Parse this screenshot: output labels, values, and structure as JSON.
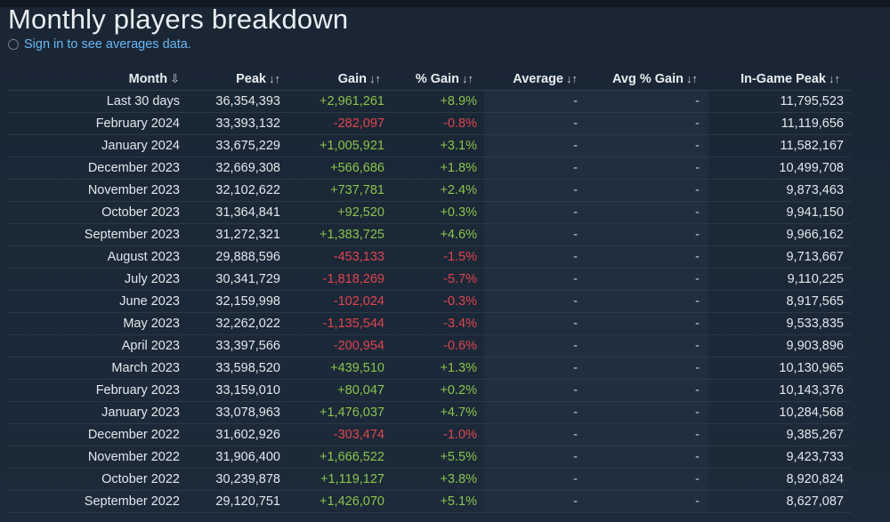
{
  "page": {
    "title": "Monthly players breakdown",
    "signin_text": "Sign in to see averages data."
  },
  "table": {
    "headers": {
      "month": "Month",
      "peak": "Peak",
      "gain": "Gain",
      "gain_pct": "% Gain",
      "average": "Average",
      "avg_gain_pct": "Avg % Gain",
      "ingame_peak": "In-Game Peak"
    },
    "sort_icons": {
      "month": "⇩",
      "other": "↓↑"
    },
    "rows": [
      {
        "month": "Last 30 days",
        "peak": "36,354,393",
        "gain": "+2,961,261",
        "gain_pct": "+8.9%",
        "average": "-",
        "avg_gain_pct": "-",
        "ingame_peak": "11,795,523",
        "trend": "pos"
      },
      {
        "month": "February 2024",
        "peak": "33,393,132",
        "gain": "-282,097",
        "gain_pct": "-0.8%",
        "average": "-",
        "avg_gain_pct": "-",
        "ingame_peak": "11,119,656",
        "trend": "neg"
      },
      {
        "month": "January 2024",
        "peak": "33,675,229",
        "gain": "+1,005,921",
        "gain_pct": "+3.1%",
        "average": "-",
        "avg_gain_pct": "-",
        "ingame_peak": "11,582,167",
        "trend": "pos"
      },
      {
        "month": "December 2023",
        "peak": "32,669,308",
        "gain": "+566,686",
        "gain_pct": "+1.8%",
        "average": "-",
        "avg_gain_pct": "-",
        "ingame_peak": "10,499,708",
        "trend": "pos"
      },
      {
        "month": "November 2023",
        "peak": "32,102,622",
        "gain": "+737,781",
        "gain_pct": "+2.4%",
        "average": "-",
        "avg_gain_pct": "-",
        "ingame_peak": "9,873,463",
        "trend": "pos"
      },
      {
        "month": "October 2023",
        "peak": "31,364,841",
        "gain": "+92,520",
        "gain_pct": "+0.3%",
        "average": "-",
        "avg_gain_pct": "-",
        "ingame_peak": "9,941,150",
        "trend": "pos"
      },
      {
        "month": "September 2023",
        "peak": "31,272,321",
        "gain": "+1,383,725",
        "gain_pct": "+4.6%",
        "average": "-",
        "avg_gain_pct": "-",
        "ingame_peak": "9,966,162",
        "trend": "pos"
      },
      {
        "month": "August 2023",
        "peak": "29,888,596",
        "gain": "-453,133",
        "gain_pct": "-1.5%",
        "average": "-",
        "avg_gain_pct": "-",
        "ingame_peak": "9,713,667",
        "trend": "neg"
      },
      {
        "month": "July 2023",
        "peak": "30,341,729",
        "gain": "-1,818,269",
        "gain_pct": "-5.7%",
        "average": "-",
        "avg_gain_pct": "-",
        "ingame_peak": "9,110,225",
        "trend": "neg"
      },
      {
        "month": "June 2023",
        "peak": "32,159,998",
        "gain": "-102,024",
        "gain_pct": "-0.3%",
        "average": "-",
        "avg_gain_pct": "-",
        "ingame_peak": "8,917,565",
        "trend": "neg"
      },
      {
        "month": "May 2023",
        "peak": "32,262,022",
        "gain": "-1,135,544",
        "gain_pct": "-3.4%",
        "average": "-",
        "avg_gain_pct": "-",
        "ingame_peak": "9,533,835",
        "trend": "neg"
      },
      {
        "month": "April 2023",
        "peak": "33,397,566",
        "gain": "-200,954",
        "gain_pct": "-0.6%",
        "average": "-",
        "avg_gain_pct": "-",
        "ingame_peak": "9,903,896",
        "trend": "neg"
      },
      {
        "month": "March 2023",
        "peak": "33,598,520",
        "gain": "+439,510",
        "gain_pct": "+1.3%",
        "average": "-",
        "avg_gain_pct": "-",
        "ingame_peak": "10,130,965",
        "trend": "pos"
      },
      {
        "month": "February 2023",
        "peak": "33,159,010",
        "gain": "+80,047",
        "gain_pct": "+0.2%",
        "average": "-",
        "avg_gain_pct": "-",
        "ingame_peak": "10,143,376",
        "trend": "pos"
      },
      {
        "month": "January 2023",
        "peak": "33,078,963",
        "gain": "+1,476,037",
        "gain_pct": "+4.7%",
        "average": "-",
        "avg_gain_pct": "-",
        "ingame_peak": "10,284,568",
        "trend": "pos"
      },
      {
        "month": "December 2022",
        "peak": "31,602,926",
        "gain": "-303,474",
        "gain_pct": "-1.0%",
        "average": "-",
        "avg_gain_pct": "-",
        "ingame_peak": "9,385,267",
        "trend": "neg"
      },
      {
        "month": "November 2022",
        "peak": "31,906,400",
        "gain": "+1,666,522",
        "gain_pct": "+5.5%",
        "average": "-",
        "avg_gain_pct": "-",
        "ingame_peak": "9,423,733",
        "trend": "pos"
      },
      {
        "month": "October 2022",
        "peak": "30,239,878",
        "gain": "+1,119,127",
        "gain_pct": "+3.8%",
        "average": "-",
        "avg_gain_pct": "-",
        "ingame_peak": "8,920,824",
        "trend": "pos"
      },
      {
        "month": "September 2022",
        "peak": "29,120,751",
        "gain": "+1,426,070",
        "gain_pct": "+5.1%",
        "average": "-",
        "avg_gain_pct": "-",
        "ingame_peak": "8,627,087",
        "trend": "pos"
      }
    ]
  },
  "colors": {
    "background": "#1b2838",
    "positive": "#8bc34a",
    "negative": "#e0444f",
    "link": "#67b8f5"
  }
}
